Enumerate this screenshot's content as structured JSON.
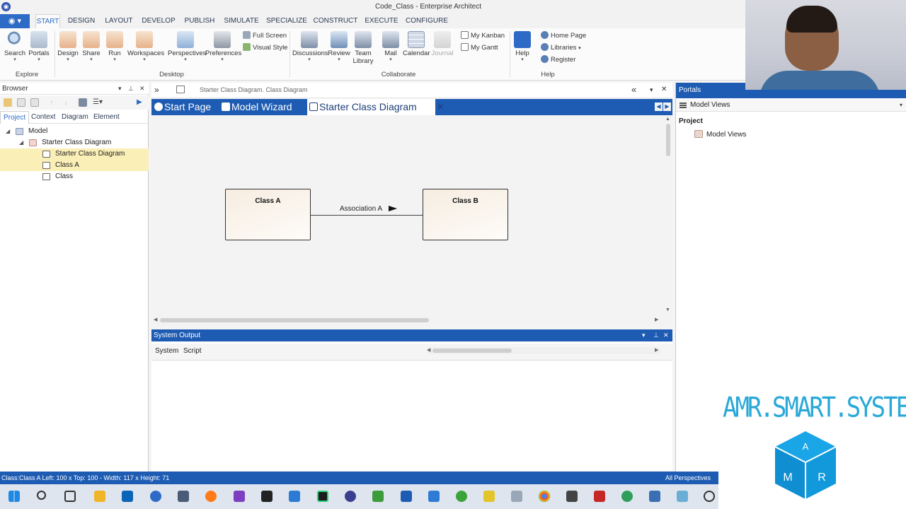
{
  "window": {
    "title": "Code_Class - Enterprise Architect"
  },
  "ribbon": {
    "tabs": [
      "START",
      "DESIGN",
      "LAYOUT",
      "DEVELOP",
      "PUBLISH",
      "SIMULATE",
      "SPECIALIZE",
      "CONSTRUCT",
      "EXECUTE",
      "CONFIGURE"
    ],
    "active_tab": "START",
    "explore": {
      "group_label": "Explore",
      "search": "Search",
      "portals": "Portals"
    },
    "desktop": {
      "group_label": "Desktop",
      "design": "Design",
      "share": "Share",
      "run": "Run",
      "workspaces": "Workspaces",
      "perspectives": "Perspectives",
      "preferences": "Preferences",
      "full_screen": "Full Screen",
      "visual_style": "Visual Style"
    },
    "collaborate": {
      "group_label": "Collaborate",
      "discussions": "Discussions",
      "review": "Review",
      "team_library_1": "Team",
      "team_library_2": "Library",
      "mail": "Mail",
      "calendar": "Calendar",
      "journal": "Journal",
      "my_kanban": "My Kanban",
      "my_gantt": "My Gantt"
    },
    "help": {
      "group_label": "Help",
      "help": "Help",
      "home_page": "Home Page",
      "libraries": "Libraries",
      "register": "Register"
    }
  },
  "browser": {
    "title": "Browser",
    "tabs": [
      "Project",
      "Context",
      "Diagram",
      "Element"
    ],
    "active_tab": "Project",
    "tree": [
      {
        "label": "Model"
      },
      {
        "label": "Starter Class Diagram"
      },
      {
        "label": "Starter Class Diagram"
      },
      {
        "label": "Class A"
      },
      {
        "label": "Class"
      }
    ]
  },
  "document": {
    "breadcrumb": "Starter Class Diagram.  Class Diagram",
    "tabs": [
      "Start Page",
      "Model Wizard",
      "Starter Class Diagram"
    ],
    "active_tab": "Starter Class Diagram"
  },
  "diagram": {
    "class_a": "Class A",
    "class_b": "Class B",
    "association": "Association A"
  },
  "system_output": {
    "title": "System Output",
    "tabs": [
      "System",
      "Script"
    ]
  },
  "portals": {
    "title": "Portals",
    "selected_view": "Model Views",
    "section": "Project",
    "item": "Model Views"
  },
  "statusbar": {
    "left": "Class:Class A   Left:    100 x Top:   100 - Width:    117 x Height:    71",
    "right": "All Perspectives"
  },
  "overlay": {
    "brand_text": "AMR.SMART.SYSTEMS",
    "cube_letters": [
      "A",
      "M",
      "R"
    ]
  },
  "colors": {
    "accent": "#1e5cb3",
    "highlight": "#fbefb8",
    "class_fill": "#f7ede1",
    "brand": "#2aa8d8"
  }
}
